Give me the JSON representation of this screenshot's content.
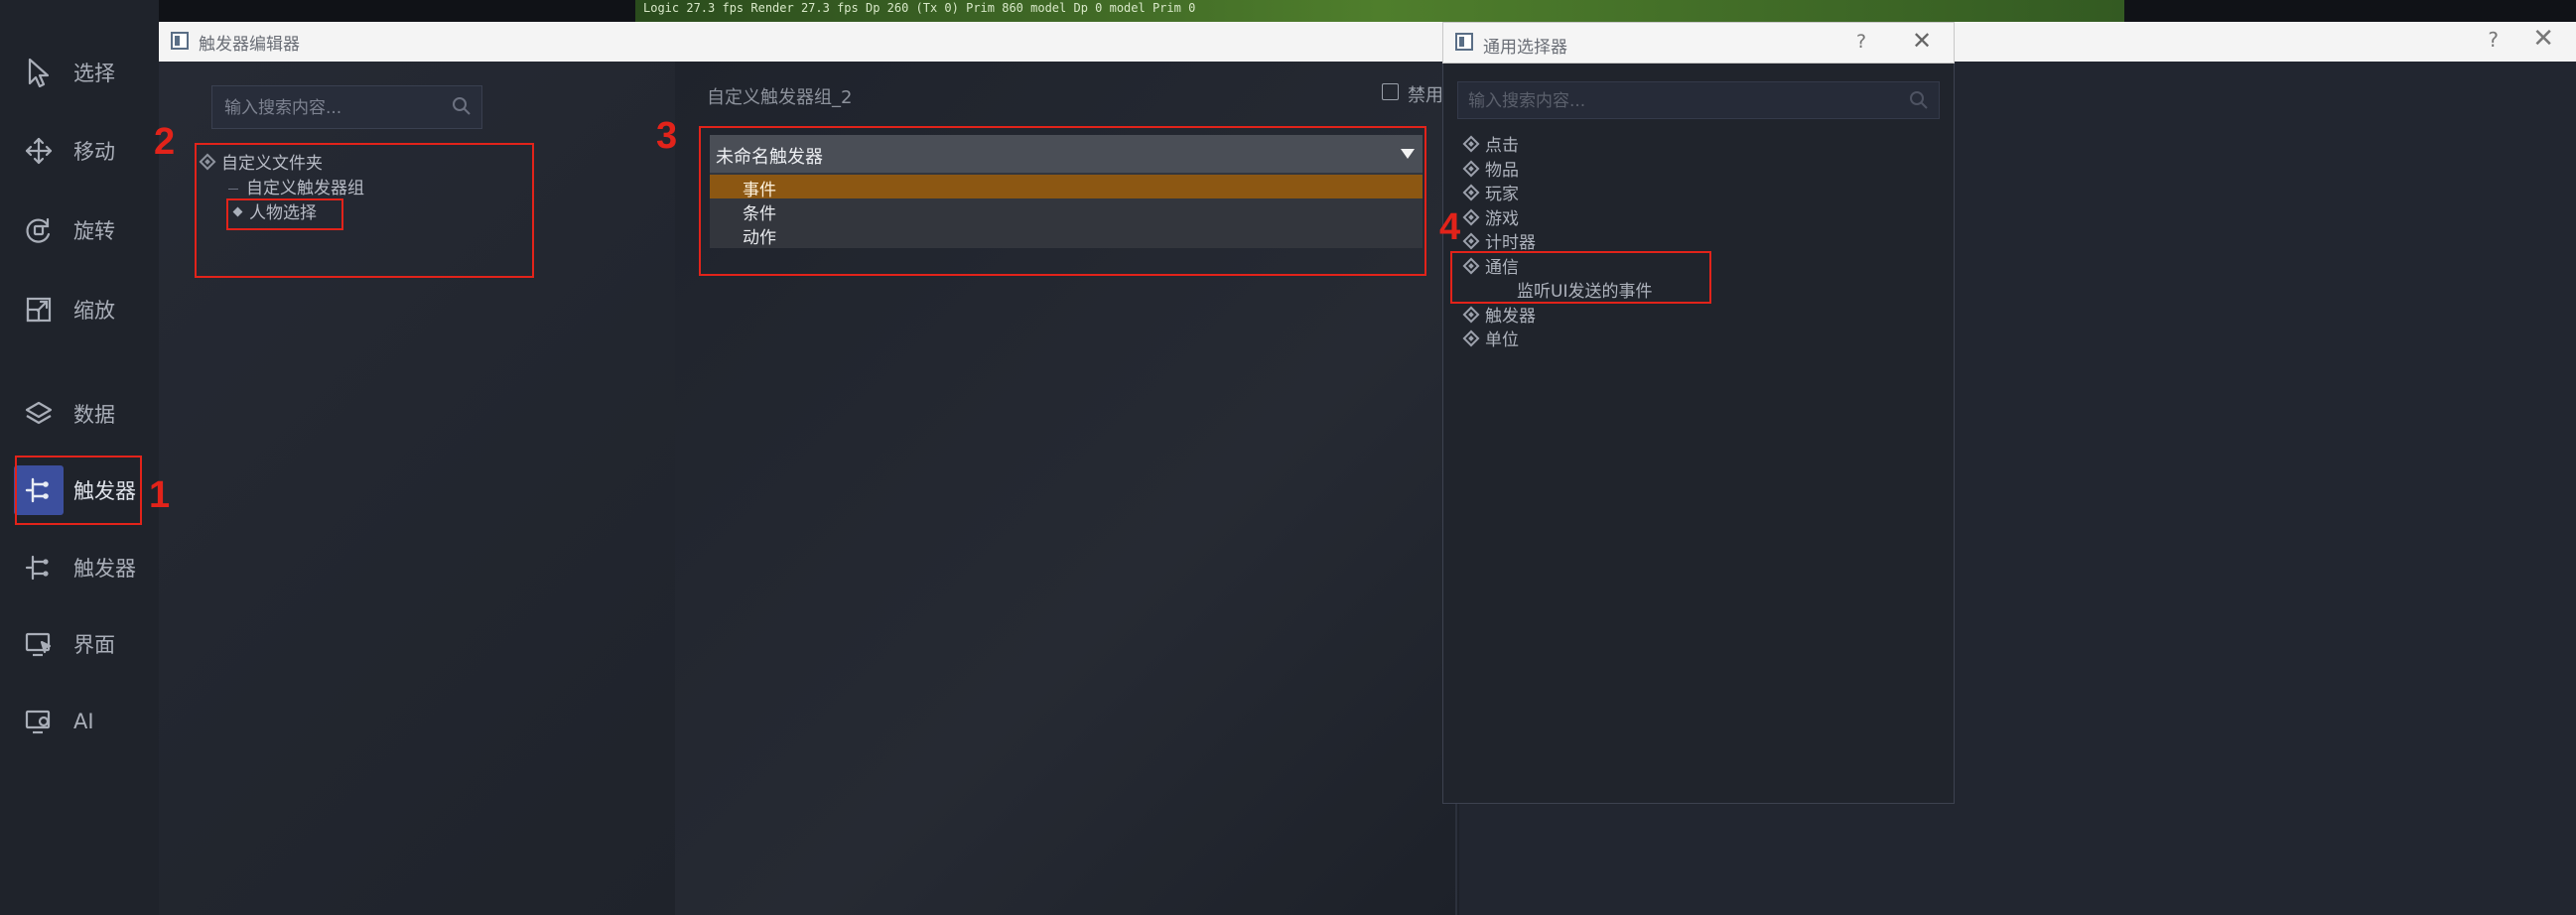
{
  "topbar": {
    "log_text": "Logic 27.3 fps  Render 27.3 fps  Dp 260 (Tx 0) Prim 860 model Dp 0 model Prim 0"
  },
  "sidebar": {
    "tools": [
      {
        "label": "选择",
        "icon": "cursor-arrow-icon"
      },
      {
        "label": "移动",
        "icon": "move-arrows-icon"
      },
      {
        "label": "旋转",
        "icon": "rotate-icon"
      },
      {
        "label": "缩放",
        "icon": "scale-icon"
      },
      {
        "label": "数据",
        "icon": "layers-icon"
      },
      {
        "label": "触发器",
        "icon": "trigger-icon",
        "active": true
      },
      {
        "label": "触发器",
        "icon": "trigger-icon"
      },
      {
        "label": "界面",
        "icon": "interface-icon"
      },
      {
        "label": "AI",
        "icon": "ai-icon"
      }
    ]
  },
  "trigger_editor": {
    "title": "触发器编辑器",
    "search_placeholder": "输入搜索内容...",
    "tree": {
      "folder": "自定义文件夹",
      "group": "自定义触发器组",
      "item": "人物选择"
    },
    "group_name": "自定义触发器组_2",
    "disable_label": "禁用",
    "trigger": {
      "name": "未命名触发器",
      "sections": [
        "事件",
        "条件",
        "动作"
      ],
      "selected_index": 0
    },
    "help_glyph": "?",
    "close_glyph": "✕"
  },
  "selector": {
    "title": "通用选择器",
    "search_placeholder": "输入搜索内容...",
    "categories": [
      "点击",
      "物品",
      "玩家",
      "游戏",
      "计时器",
      "通信",
      "触发器",
      "单位"
    ],
    "expanded_category": "通信",
    "sub_item": "监听UI发送的事件",
    "help_glyph": "?",
    "close_glyph": "✕"
  },
  "annotations": [
    "1",
    "2",
    "3",
    "4"
  ],
  "colors": {
    "accent_selected": "#8c5712",
    "active_tool": "#3c4f9e",
    "annotation_red": "#e2231a"
  }
}
